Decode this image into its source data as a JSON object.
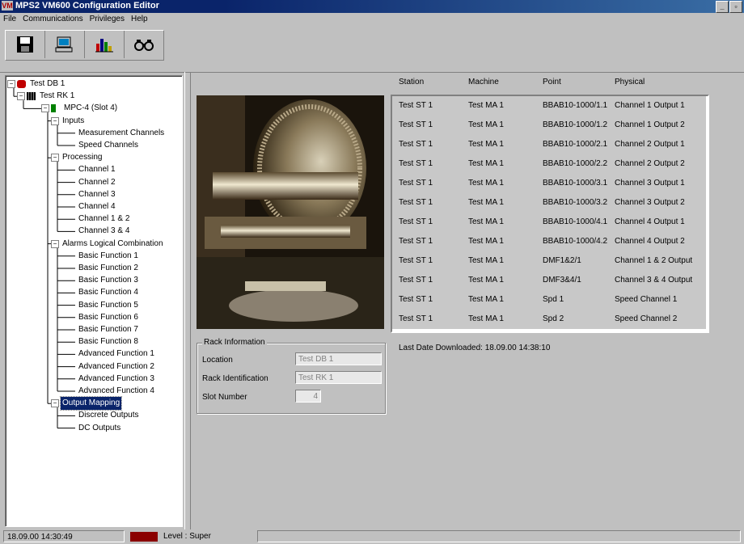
{
  "window": {
    "title": "MPS2 VM600 Configuration Editor",
    "logo": "VM"
  },
  "menu": [
    "File",
    "Communications",
    "Privileges",
    "Help"
  ],
  "toolbar": {
    "icons": [
      "save-icon",
      "computer-icon",
      "chart-icon",
      "binoculars-icon"
    ]
  },
  "tree": [
    {
      "label": "Test DB 1",
      "icon": "database-icon",
      "level": 0
    },
    {
      "label": "Test RK 1",
      "icon": "rack-icon",
      "level": 1
    },
    {
      "label": "MPC-4 (Slot  4)",
      "icon": "card-icon",
      "level": 2
    },
    {
      "label": "Inputs",
      "level": 3
    },
    {
      "label": "Measurement Channels",
      "level": 4
    },
    {
      "label": "Speed Channels",
      "level": 4
    },
    {
      "label": "Processing",
      "level": 3
    },
    {
      "label": "Channel 1",
      "level": 4
    },
    {
      "label": "Channel 2",
      "level": 4
    },
    {
      "label": "Channel 3",
      "level": 4
    },
    {
      "label": "Channel 4",
      "level": 4
    },
    {
      "label": "Channel 1 & 2",
      "level": 4
    },
    {
      "label": "Channel 3 & 4",
      "level": 4
    },
    {
      "label": "Alarms Logical Combination",
      "level": 3
    },
    {
      "label": "Basic Function 1",
      "level": 4
    },
    {
      "label": "Basic Function 2",
      "level": 4
    },
    {
      "label": "Basic Function 3",
      "level": 4
    },
    {
      "label": "Basic Function 4",
      "level": 4
    },
    {
      "label": "Basic Function 5",
      "level": 4
    },
    {
      "label": "Basic Function 6",
      "level": 4
    },
    {
      "label": "Basic Function 7",
      "level": 4
    },
    {
      "label": "Basic Function 8",
      "level": 4
    },
    {
      "label": "Advanced Function 1",
      "level": 4
    },
    {
      "label": "Advanced Function 2",
      "level": 4
    },
    {
      "label": "Advanced Function 3",
      "level": 4
    },
    {
      "label": "Advanced Function 4",
      "level": 4
    },
    {
      "label": "Output Mapping",
      "level": 3,
      "selected": true
    },
    {
      "label": "Discrete Outputs",
      "level": 4
    },
    {
      "label": "DC Outputs",
      "level": 4
    }
  ],
  "table": {
    "headers": [
      "Station",
      "Machine",
      "Point",
      "Physical"
    ],
    "rows": [
      [
        "Test ST 1",
        "Test MA 1",
        "BBAB10-1000/1.1",
        "Channel 1 Output 1"
      ],
      [
        "Test ST 1",
        "Test MA 1",
        "BBAB10-1000/1.2",
        "Channel 1 Output 2"
      ],
      [
        "Test ST 1",
        "Test MA 1",
        "BBAB10-1000/2.1",
        "Channel 2 Output 1"
      ],
      [
        "Test ST 1",
        "Test MA 1",
        "BBAB10-1000/2.2",
        "Channel 2 Output 2"
      ],
      [
        "Test ST 1",
        "Test MA 1",
        "BBAB10-1000/3.1",
        "Channel 3 Output 1"
      ],
      [
        "Test ST 1",
        "Test MA 1",
        "BBAB10-1000/3.2",
        "Channel 3 Output 2"
      ],
      [
        "Test ST 1",
        "Test MA 1",
        "BBAB10-1000/4.1",
        "Channel 4 Output 1"
      ],
      [
        "Test ST 1",
        "Test MA 1",
        "BBAB10-1000/4.2",
        "Channel 4 Output 2"
      ],
      [
        "Test ST 1",
        "Test MA 1",
        "DMF1&2/1",
        "Channel 1 & 2 Output"
      ],
      [
        "Test ST 1",
        "Test MA 1",
        "DMF3&4/1",
        "Channel 3 & 4 Output"
      ],
      [
        "Test ST 1",
        "Test MA 1",
        "Spd 1",
        "Speed Channel 1"
      ],
      [
        "Test ST 1",
        "Test MA 1",
        "Spd 2",
        "Speed Channel 2"
      ]
    ]
  },
  "last_download": {
    "label": "Last Date Downloaded:",
    "value": "18.09.00 14:38:10"
  },
  "rack_info": {
    "title": "Rack Information",
    "location_label": "Location",
    "location_value": "Test DB 1",
    "rack_id_label": "Rack Identification",
    "rack_id_value": "Test RK 1",
    "slot_label": "Slot Number",
    "slot_value": "4"
  },
  "status": {
    "time": "18.09.00 14:30:49",
    "level": "Level : Super",
    "indicator_color": "#8b0000"
  }
}
